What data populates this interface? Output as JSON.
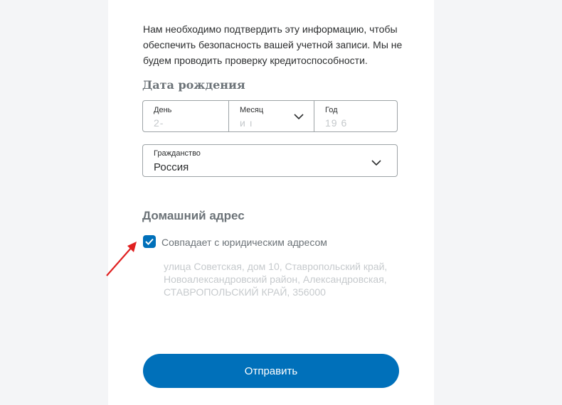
{
  "intro": {
    "text": "Нам необходимо подтвердить эту информацию, чтобы обеспечить безопасность вашей учетной записи. Мы не будем проводить проверку кредитоспособности."
  },
  "birth_date": {
    "title": "Дата рождения",
    "day": {
      "label": "День",
      "value": "2-"
    },
    "month": {
      "label": "Месяц",
      "value": "и   ı"
    },
    "year": {
      "label": "Год",
      "value": "19  6"
    }
  },
  "citizenship": {
    "label": "Гражданство",
    "value": "Россия"
  },
  "home_address": {
    "title": "Домашний адрес",
    "checkbox_label": "Совпадает с юридическим адресом",
    "checked": true,
    "address_text": "улица Советская, дом 10, Ставропольский край, Новоалександровский район, Александровская, СТАВРОПОЛЬСКИЙ КРАЙ, 356000"
  },
  "submit": {
    "label": "Отправить"
  },
  "colors": {
    "accent": "#0070ba",
    "annotation_arrow": "#e02020"
  },
  "icons": {
    "dropdown": "chevron-down-icon",
    "check": "checkmark-icon",
    "annotation": "red-arrow-icon"
  }
}
